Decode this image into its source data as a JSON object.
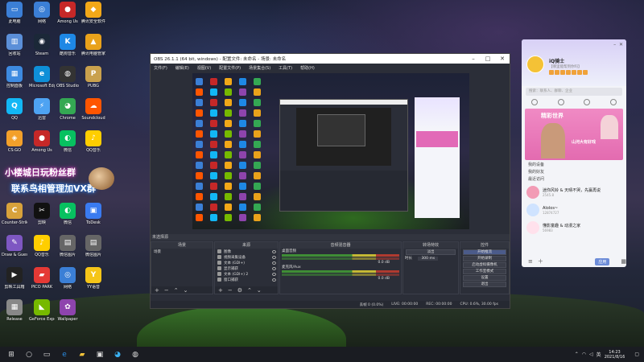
{
  "desktop_icons": [
    {
      "label": "此电脑",
      "color": "#3b7fd6",
      "glyph": "▭"
    },
    {
      "label": "网络",
      "color": "#3b7fd6",
      "glyph": "◎"
    },
    {
      "label": "Among Us",
      "color": "#c62828",
      "glyph": "●"
    },
    {
      "label": "腾讯安全软件",
      "color": "#f2a818",
      "glyph": "◆"
    },
    {
      "label": "回收站",
      "color": "#5b8fd8",
      "glyph": "▥"
    },
    {
      "label": "Steam",
      "color": "#1b2838",
      "glyph": "◉"
    },
    {
      "label": "酷狗音乐",
      "color": "#1e88e5",
      "glyph": "K"
    },
    {
      "label": "腾讯电脑管家",
      "color": "#e9a21b",
      "glyph": "▲"
    },
    {
      "label": "控制面板",
      "color": "#3d8ae0",
      "glyph": "▦"
    },
    {
      "label": "Microsoft Edge",
      "color": "#0e8fd8",
      "glyph": "e"
    },
    {
      "label": "OBS Studio",
      "color": "#333",
      "glyph": "◍"
    },
    {
      "label": "PUBG",
      "color": "#c9a14d",
      "glyph": "P"
    },
    {
      "label": "QQ",
      "color": "#12b7f5",
      "glyph": "Q"
    },
    {
      "label": "迅雷",
      "color": "#4ea3f2",
      "glyph": "⚡"
    },
    {
      "label": "Chrome",
      "color": "#34a853",
      "glyph": "◕"
    },
    {
      "label": "Soundcloud",
      "color": "#ff5500",
      "glyph": "☁"
    },
    {
      "label": "CS:GO",
      "color": "#f3a02a",
      "glyph": "◈"
    },
    {
      "label": "Among Us",
      "color": "#c62828",
      "glyph": "●"
    },
    {
      "label": "微信",
      "color": "#07c160",
      "glyph": "◐"
    },
    {
      "label": "QQ音乐",
      "color": "#ffce00",
      "glyph": "♪"
    },
    {
      "label": "Counter-Strike Global Off...",
      "color": "#d8a23b",
      "glyph": "C"
    },
    {
      "label": "剪映",
      "color": "#111",
      "glyph": "✂"
    },
    {
      "label": "微信",
      "color": "#07c160",
      "glyph": "◐"
    },
    {
      "label": "ToDesk",
      "color": "#3a7bf0",
      "glyph": "▣"
    },
    {
      "label": "Draw & Guess",
      "color": "#7e57c2",
      "glyph": "✎"
    },
    {
      "label": "QQ音乐",
      "color": "#ffce00",
      "glyph": "♪"
    },
    {
      "label": "微信图片",
      "color": "#666",
      "glyph": "▤"
    },
    {
      "label": "微信图片",
      "color": "#666",
      "glyph": "▤"
    },
    {
      "label": "剪映工具箱",
      "color": "#222",
      "glyph": "▶"
    },
    {
      "label": "PICO PARK",
      "color": "#e53935",
      "glyph": "▰"
    },
    {
      "label": "网络",
      "color": "#3b7fd6",
      "glyph": "◎"
    },
    {
      "label": "YY语音",
      "color": "#f5c518",
      "glyph": "Y"
    },
    {
      "label": "Release",
      "color": "#888",
      "glyph": "▦"
    },
    {
      "label": "GeForce Experience",
      "color": "#76b900",
      "glyph": "◣"
    },
    {
      "label": "Wallpaper",
      "color": "#8e44ad",
      "glyph": "✿"
    }
  ],
  "banner": {
    "line1": "小楼城日玩粉丝群",
    "line2": "联系鸟相管理加VX群"
  },
  "obs": {
    "title": "OBS 26.1.1 (64 bit, windows) - 配置文件: 未命名 - 场景: 未命名",
    "menu": [
      "文件(F)",
      "编辑(E)",
      "视图(V)",
      "配置文件(P)",
      "场景集合(S)",
      "工具(T)",
      "帮助(H)"
    ],
    "status_header": "未选择源",
    "scenes_title": "场景",
    "sources_title": "来源",
    "mixer_title": "音频混音器",
    "transitions_title": "转场特效",
    "controls_title": "控件",
    "scene_item": "场景",
    "sources": [
      "图像",
      "视频采集设备",
      "文本 (GDI+)",
      "显示捕获",
      "文本 (GDI+) 2",
      "窗口捕获"
    ],
    "mixer": [
      {
        "name": "桌面音频",
        "db": "0.0 dB"
      },
      {
        "name": "麦克风/Aux",
        "db": "0.0 dB"
      }
    ],
    "transition_value": "淡出",
    "duration_label": "时长",
    "duration_value": "300 ms",
    "controls": [
      "开始推流",
      "开始录制",
      "启动虚拟摄像机",
      "工作室模式",
      "设置",
      "退出"
    ],
    "status": [
      "丢帧 0 (0.0%)",
      "LIVE: 00:00:00",
      "REC: 00:00:00",
      "CPU: 0.6%, 30.00 fps"
    ]
  },
  "qq": {
    "username": "iQ骑士",
    "status_text": "【哪里能帮到你吗】",
    "search_placeholder": "搜索：联系人、群聊、企业",
    "ad_title": "精彩世界",
    "ad_sub": "山河大有好戏",
    "groups": [
      "我的设备",
      "我的好友",
      "最近访问"
    ],
    "contacts": [
      {
        "name": "迷你风铃 & 天晴不哭，先赢再说",
        "sub": "2545.8"
      },
      {
        "name": "Alolos~",
        "sub": "12874727"
      },
      {
        "name": "懂影童趣 & 动漫之家",
        "sub": "56983"
      }
    ],
    "apps_label": "应用"
  },
  "taskbar": {
    "time": "14:23",
    "date": "2021/8/16"
  }
}
